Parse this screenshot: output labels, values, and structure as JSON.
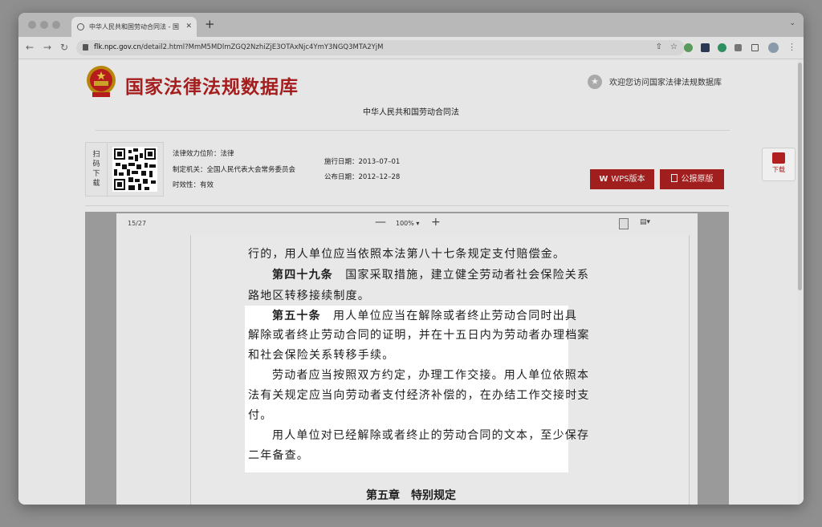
{
  "browser": {
    "tab_title": "中华人民共和国劳动合同法 - 国",
    "tab_close": "✕",
    "new_tab": "+",
    "url_domain": "flk.npc.gov.cn",
    "url_path": "/detail2.html?MmM5MDlmZGQ2NzhiZjE3OTAxNjc4YmY3NGQ3MTA2YjM",
    "nav_back": "←",
    "nav_forward": "→",
    "nav_reload": "↻",
    "share_icon": "⇧",
    "star_icon": "☆",
    "menu_icon": "⋮",
    "tab_menu": "⌄"
  },
  "site": {
    "logo_text": "国家法律法规数据库",
    "welcome": "欢迎您访问国家法律法规数据库",
    "law_title": "中华人民共和国劳动合同法"
  },
  "meta": {
    "qr_label": [
      "扫",
      "码",
      "下",
      "载"
    ],
    "level": "法律效力位阶：法律",
    "authority": "制定机关：全国人民代表大会常务委员会",
    "status": "时效性：有效",
    "effective_date": "施行日期：2013–07–01",
    "publish_date": "公布日期：2012–12–28"
  },
  "buttons": {
    "wps": "WPS版本",
    "original": "公报原版",
    "download": "下载"
  },
  "pdf": {
    "page_indicator": "15/27",
    "zoom": "100%",
    "zoom_minus": "—",
    "zoom_plus": "+",
    "lines": [
      "行的，用人单位应当依照本法第八十七条规定支付赔偿金。",
      "路地区转移接续制度。",
      "解除或者终止劳动合同的证明，并在十五日内为劳动者办理档案",
      "和社会保险关系转移手续。",
      "劳动者应当按照双方约定，办理工作交接。用人单位依照本",
      "法有关规定应当向劳动者支付经济补偿的，在办结工作交接时支",
      "付。",
      "用人单位对已经解除或者终止的劳动合同的文本，至少保存",
      "二年备查。"
    ],
    "art49_label": "第四十九条",
    "art49_text": "国家采取措施，建立健全劳动者社会保险关系",
    "art50_label": "第五十条",
    "art50_text": "用人单位应当在解除或者终止劳动合同时出具",
    "chapter": "第五章　特别规定"
  }
}
